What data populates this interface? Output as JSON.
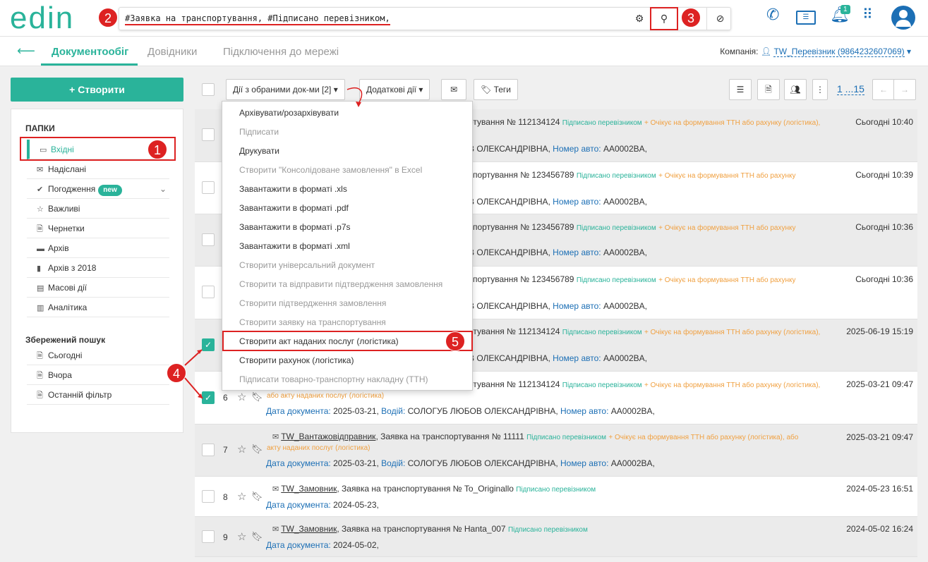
{
  "brand": {
    "logo": "edin"
  },
  "search": {
    "query": "#Заявка на транспортування, #Підписано перевізником,"
  },
  "header": {
    "notif_count": "1"
  },
  "nav": {
    "tabs": [
      {
        "label": "Документообіг"
      },
      {
        "label": "Довідники"
      },
      {
        "label": "Підключення до мережі"
      }
    ],
    "company_label": "Компанія:",
    "company_value": "TW_Перевізник (9864232607069)"
  },
  "sidebar": {
    "create_label": "+ Створити",
    "folders_title": "ПАПКИ",
    "items": [
      {
        "label": "Вхідні"
      },
      {
        "label": "Надіслані"
      },
      {
        "label": "Погодження",
        "badge": "new"
      },
      {
        "label": "Важливі"
      },
      {
        "label": "Чернетки"
      },
      {
        "label": "Архів"
      },
      {
        "label": "Архів з 2018"
      },
      {
        "label": "Масові дії"
      },
      {
        "label": "Аналітика"
      }
    ],
    "saved_title": "Збережений пошук",
    "saved": [
      {
        "label": "Сьогодні"
      },
      {
        "label": "Вчора"
      },
      {
        "label": "Останній фільтр"
      }
    ]
  },
  "toolbar": {
    "actions_label": "Дії з обраними док-ми [2]",
    "extra_label": "Додаткові дії",
    "tags_label": "Теги",
    "pager": "1 ...15"
  },
  "menu": {
    "items": [
      {
        "label": "Архівувати/розархівувати",
        "enabled": true
      },
      {
        "label": "Підписати",
        "enabled": false
      },
      {
        "label": "Друкувати",
        "enabled": true
      },
      {
        "label": "Створити \"Консолідоване замовлення\" в Excel",
        "enabled": false
      },
      {
        "label": "Завантажити в форматі .xls",
        "enabled": true
      },
      {
        "label": "Завантажити в форматі .pdf",
        "enabled": true
      },
      {
        "label": "Завантажити в форматі .p7s",
        "enabled": true
      },
      {
        "label": "Завантажити в форматі .xml",
        "enabled": true
      },
      {
        "label": "Створити універсальний документ",
        "enabled": false
      },
      {
        "label": "Створити та відправити підтвердження замовлення",
        "enabled": false
      },
      {
        "label": "Створити підтвердження замовлення",
        "enabled": false
      },
      {
        "label": "Створити заявку на транспортування",
        "enabled": false
      },
      {
        "label": "Створити акт наданих послуг (логістика)",
        "enabled": true
      },
      {
        "label": "Створити рахунок (логістика)",
        "enabled": true
      },
      {
        "label": "Підписати товарно-транспортну накладну (ТТН)",
        "enabled": false
      }
    ]
  },
  "rows": [
    {
      "l1": "ртування № 112134124",
      "signed": "Підписано перевізником",
      "wait": "+ Очікує на формування ТТН або рахунку (логістика),",
      "l2": "В ОЛЕКСАНДРІВНА,",
      "car_k": "Номер авто:",
      "car": "AA0002BA,",
      "date": "Сьогодні 10:40"
    },
    {
      "l1": "спортування № 123456789",
      "signed": "Підписано перевізником",
      "wait": "+ Очікує на формування ТТН або рахунку",
      "l2": "В ОЛЕКСАНДРІВНА,",
      "car_k": "Номер авто:",
      "car": "AA0002BA,",
      "date": "Сьогодні 10:39"
    },
    {
      "l1": "спортування № 123456789",
      "signed": "Підписано перевізником",
      "wait": "+ Очікує на формування ТТН або рахунку",
      "l2": "В ОЛЕКСАНДРІВНА,",
      "car_k": "Номер авто:",
      "car": "AA0002BA,",
      "date": "Сьогодні 10:36"
    },
    {
      "l1": "спортування № 123456789",
      "signed": "Підписано перевізником",
      "wait": "+ Очікує на формування ТТН або рахунку",
      "l2": "В ОЛЕКСАНДРІВНА,",
      "car_k": "Номер авто:",
      "car": "AA0002BA,",
      "date": "Сьогодні 10:36"
    },
    {
      "l1": "ртування № 112134124",
      "signed": "Підписано перевізником",
      "wait": "+ Очікує на формування ТТН або рахунку (логістика),",
      "l2": "В ОЛЕКСАНДРІВНА,",
      "car_k": "Номер авто:",
      "car": "AA0002BA,",
      "date": "2025-06-19 15:19"
    },
    {
      "num": "6",
      "l1": "ртування № 112134124",
      "signed": "Підписано перевізником",
      "wait": "+ Очікує на формування ТТН або рахунку (логістика),",
      "wait2": "або акту наданих послуг (логістика)",
      "dk": "Дата документа:",
      "dv": "2025-03-21,",
      "vk": "Водій:",
      "vv": "СОЛОГУБ ЛЮБОВ ОЛЕКСАНДРІВНА,",
      "car_k": "Номер авто:",
      "car": "AA0002BA,",
      "date": "2025-03-21 09:47"
    },
    {
      "num": "7",
      "sender": "TW_Вантажовідправник",
      "title": ", Заявка на транспортування № 11111",
      "signed": "Підписано перевізником",
      "wait": "+ Очікує на формування ТТН або рахунку (логістика), або",
      "wait2": "акту наданих послуг (логістика)",
      "dk": "Дата документа:",
      "dv": "2025-03-21,",
      "vk": "Водій:",
      "vv": "СОЛОГУБ ЛЮБОВ ОЛЕКСАНДРІВНА,",
      "car_k": "Номер авто:",
      "car": "AA0002BA,",
      "date": "2025-03-21 09:47"
    },
    {
      "num": "8",
      "sender": "TW_Замовник",
      "title": ", Заявка на транспортування № To_Originallo",
      "signed": "Підписано перевізником",
      "dk": "Дата документа:",
      "dv": "2024-05-23,",
      "date": "2024-05-23 16:51"
    },
    {
      "num": "9",
      "sender": "TW_Замовник",
      "title": ", Заявка на транспортування № Hanta_007",
      "signed": "Підписано перевізником",
      "dk": "Дата документа:",
      "dv": "2024-05-02,",
      "date": "2024-05-02 16:24"
    }
  ],
  "markers": [
    "1",
    "2",
    "3",
    "4",
    "5"
  ]
}
